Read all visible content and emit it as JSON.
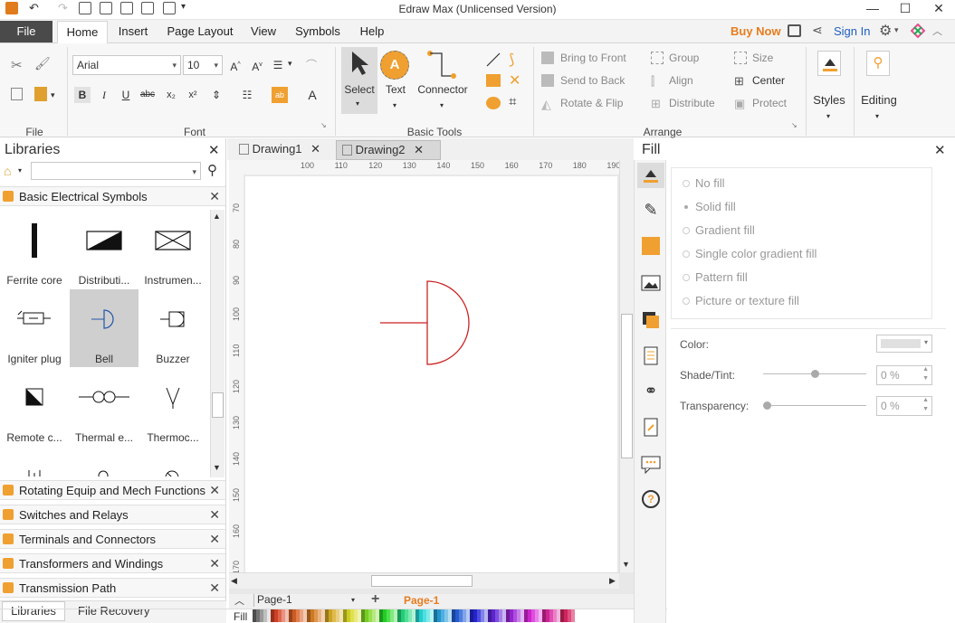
{
  "app": {
    "title": "Edraw Max (Unlicensed Version)",
    "buy_now": "Buy Now",
    "sign_in": "Sign In"
  },
  "tabs": [
    {
      "label": "File"
    },
    {
      "label": "Home"
    },
    {
      "label": "Insert"
    },
    {
      "label": "Page Layout"
    },
    {
      "label": "View"
    },
    {
      "label": "Symbols"
    },
    {
      "label": "Help"
    }
  ],
  "ribbon": {
    "font_name": "Arial",
    "font_size": "10",
    "groups": {
      "file": "File",
      "font": "Font",
      "basic_tools": "Basic Tools",
      "arrange": "Arrange"
    },
    "tools": {
      "select": "Select",
      "text": "Text",
      "connector": "Connector"
    },
    "arrange": {
      "bring_to_front": "Bring to Front",
      "send_to_back": "Send to Back",
      "rotate_flip": "Rotate & Flip",
      "group": "Group",
      "align": "Align",
      "distribute": "Distribute",
      "size": "Size",
      "center": "Center",
      "protect": "Protect"
    },
    "styles": "Styles",
    "editing": "Editing"
  },
  "libraries": {
    "title": "Libraries",
    "open_library": "Basic Electrical Symbols",
    "symbols": [
      {
        "label": "Ferrite core",
        "icon": "ferrite-core-icon"
      },
      {
        "label": "Distributi...",
        "icon": "distribution-icon"
      },
      {
        "label": "Instrumen...",
        "icon": "instrument-icon"
      },
      {
        "label": "Igniter plug",
        "icon": "igniter-plug-icon"
      },
      {
        "label": "Bell",
        "icon": "bell-icon"
      },
      {
        "label": "Buzzer",
        "icon": "buzzer-icon"
      },
      {
        "label": "Remote c...",
        "icon": "remote-control-icon"
      },
      {
        "label": "Thermal e...",
        "icon": "thermal-element-icon"
      },
      {
        "label": "Thermoc...",
        "icon": "thermocouple-icon"
      }
    ],
    "collapsed": [
      "Rotating Equip and Mech Functions",
      "Switches and Relays",
      "Terminals and Connectors",
      "Transformers and Windings",
      "Transmission Path"
    ],
    "bottom_tabs": [
      "Libraries",
      "File Recovery"
    ]
  },
  "documents": [
    {
      "label": "Drawing1"
    },
    {
      "label": "Drawing2"
    }
  ],
  "ruler": {
    "h": [
      "100",
      "110",
      "120",
      "130",
      "140",
      "150",
      "160",
      "170",
      "180",
      "190",
      "20"
    ],
    "v": [
      "70",
      "80",
      "90",
      "100",
      "110",
      "120",
      "130",
      "140",
      "150",
      "160",
      "170"
    ]
  },
  "page_tabs": {
    "current": "Page-1",
    "active": "Page-1"
  },
  "fill": {
    "title": "Fill",
    "options": [
      "No fill",
      "Solid fill",
      "Gradient fill",
      "Single color gradient fill",
      "Pattern fill",
      "Picture or texture fill"
    ],
    "color_label": "Color:",
    "shade_label": "Shade/Tint:",
    "shade_value": "0 %",
    "transparency_label": "Transparency:",
    "transparency_value": "0 %"
  },
  "status": {
    "fill_label": "Fill"
  },
  "colors": {
    "accent": "#f0a030",
    "buy": "#e87c1e",
    "signin": "#1f5fbf",
    "shape_stroke": "#cc2222",
    "file_tab": "#4a4a4a"
  }
}
